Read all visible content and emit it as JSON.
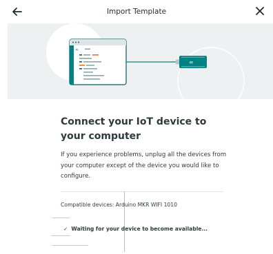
{
  "header": {
    "title": "Import Template",
    "back_icon": "arrow-left-icon",
    "close_icon": "close-icon"
  },
  "hero": {
    "illustration": "ide-to-board-illustration",
    "colors": {
      "background": "#eef1f1",
      "accent": "#008184",
      "code_orange": "#e47128"
    }
  },
  "content": {
    "heading": "Connect your IoT device to your computer",
    "description": "If you experience problems, unplug all the devices from your computer except of the device you would like to configure.",
    "compatible_devices": "Compatible devices: Arduino MKR WIFI 1010",
    "status": {
      "icon": "check-icon",
      "text": "Waiting for your device to become available..."
    }
  }
}
